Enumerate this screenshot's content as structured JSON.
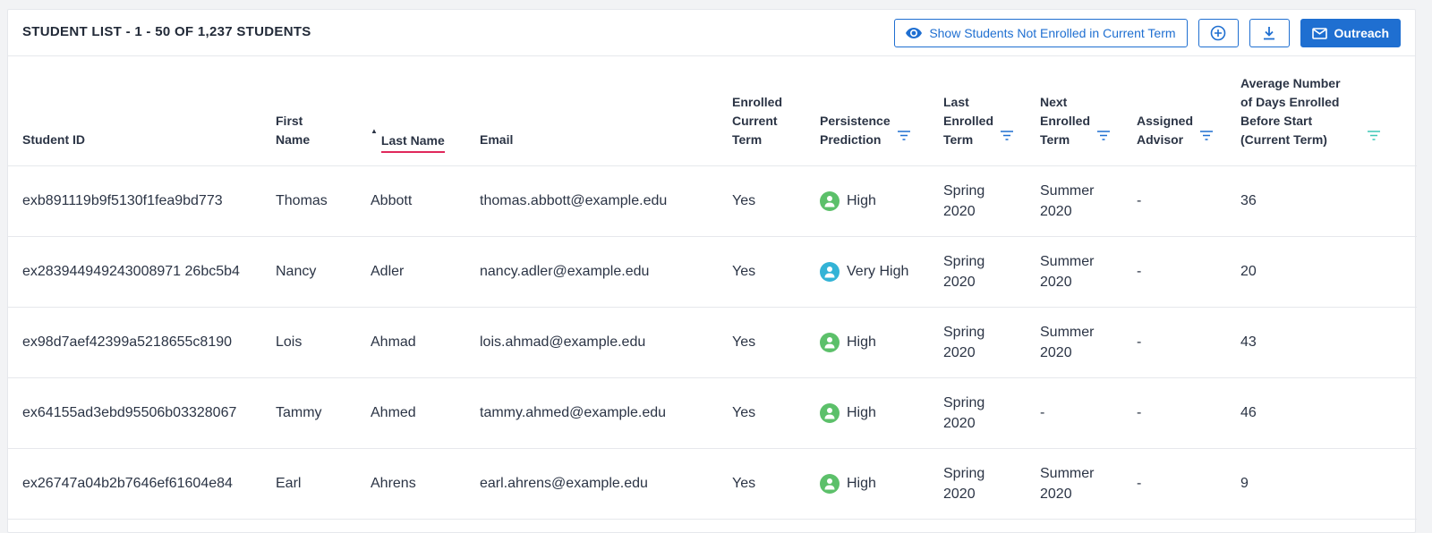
{
  "header": {
    "title": "STUDENT LIST - 1 - 50 OF 1,237 STUDENTS",
    "show_not_enrolled_label": "Show Students Not Enrolled in Current Term",
    "outreach_label": "Outreach"
  },
  "icons": {
    "eye": "eye-icon",
    "add": "plus-circle-icon",
    "download": "download-icon",
    "mail": "mail-icon",
    "filter": "filter-icon",
    "person": "person-icon",
    "sort": "sort-ascending-icon"
  },
  "colors": {
    "accent": "#1f6fd1",
    "sort_underline": "#e0285b",
    "high": "#5cc06a",
    "very_high": "#33b3d6",
    "filter_active": "#3cc7b6"
  },
  "columns": {
    "student_id": "Student ID",
    "first_name_1": "First",
    "first_name_2": "Name",
    "last_name": "Last Name",
    "email": "Email",
    "enrolled_1": "Enrolled",
    "enrolled_2": "Current",
    "enrolled_3": "Term",
    "persistence_1": "Persistence",
    "persistence_2": "Prediction",
    "last_enrolled_1": "Last",
    "last_enrolled_2": "Enrolled",
    "last_enrolled_3": "Term",
    "next_enrolled_1": "Next",
    "next_enrolled_2": "Enrolled",
    "next_enrolled_3": "Term",
    "advisor_1": "Assigned",
    "advisor_2": "Advisor",
    "avg_days_1": "Average Number",
    "avg_days_2": "of Days Enrolled",
    "avg_days_3": "Before Start",
    "avg_days_4": "(Current Term)"
  },
  "rows": [
    {
      "id": "exb891119b9f5130f1fea9bd773",
      "first": "Thomas",
      "last": "Abbott",
      "email": "thomas.abbott@example.edu",
      "enrolled": "Yes",
      "prediction": "High",
      "prediction_level": "high",
      "last_term_1": "Spring",
      "last_term_2": "2020",
      "next_term_1": "Summer",
      "next_term_2": "2020",
      "advisor": "-",
      "avg_days": "36"
    },
    {
      "id": "ex283944949243008971 26bc5b4",
      "first": "Nancy",
      "last": "Adler",
      "email": "nancy.adler@example.edu",
      "enrolled": "Yes",
      "prediction": "Very High",
      "prediction_level": "very_high",
      "last_term_1": "Spring",
      "last_term_2": "2020",
      "next_term_1": "Summer",
      "next_term_2": "2020",
      "advisor": "-",
      "avg_days": "20"
    },
    {
      "id": "ex98d7aef42399a5218655c8190",
      "first": "Lois",
      "last": "Ahmad",
      "email": "lois.ahmad@example.edu",
      "enrolled": "Yes",
      "prediction": "High",
      "prediction_level": "high",
      "last_term_1": "Spring",
      "last_term_2": "2020",
      "next_term_1": "Summer",
      "next_term_2": "2020",
      "advisor": "-",
      "avg_days": "43"
    },
    {
      "id": "ex64155ad3ebd95506b03328067",
      "first": "Tammy",
      "last": "Ahmed",
      "email": "tammy.ahmed@example.edu",
      "enrolled": "Yes",
      "prediction": "High",
      "prediction_level": "high",
      "last_term_1": "Spring",
      "last_term_2": "2020",
      "next_term_1": "-",
      "next_term_2": "",
      "advisor": "-",
      "avg_days": "46"
    },
    {
      "id": "ex26747a04b2b7646ef61604e84",
      "first": "Earl",
      "last": "Ahrens",
      "email": "earl.ahrens@example.edu",
      "enrolled": "Yes",
      "prediction": "High",
      "prediction_level": "high",
      "last_term_1": "Spring",
      "last_term_2": "2020",
      "next_term_1": "Summer",
      "next_term_2": "2020",
      "advisor": "-",
      "avg_days": "9"
    }
  ]
}
